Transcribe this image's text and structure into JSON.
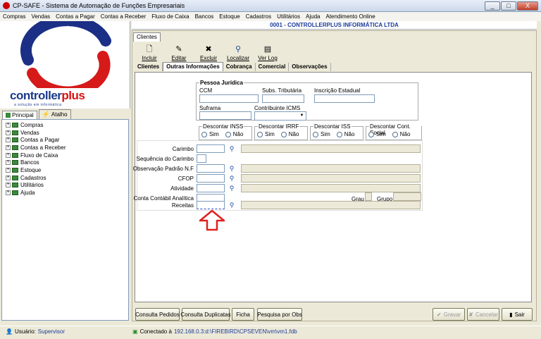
{
  "window": {
    "title": "CP-SAFE - Sistema de Automação de Funções Empresariais",
    "buttons": [
      "_",
      "□",
      "X"
    ]
  },
  "menu": [
    "Compras",
    "Vendas",
    "Contas a Pagar",
    "Contas a Receber",
    "Fluxo de Caixa",
    "Bancos",
    "Estoque",
    "Cadastros",
    "Utilitários",
    "Ajuda",
    "Atendimento Online"
  ],
  "logo": {
    "brand_a": "controller",
    "brand_b": "plus",
    "tagline": "a solução em informática"
  },
  "side_tabs": {
    "principal": "Principal",
    "atalho": "Atalho"
  },
  "tree": [
    "Compras",
    "Vendas",
    "Contas a Pagar",
    "Contas a Receber",
    "Fluxo de Caixa",
    "Bancos",
    "Estoque",
    "Cadastros",
    "Utilitários",
    "Ajuda"
  ],
  "company": "0001 - CONTROLLERPLUS INFORMÁTICA LTDA",
  "doc_tab": "Clientes",
  "toolbar": {
    "incluir": "Incluir",
    "editar": "Editar",
    "excluir": "Excluir",
    "localizar": "Localizar",
    "verlog": "Ver Log"
  },
  "subtabs": [
    "Clientes",
    "Outras Informações",
    "Cobrança",
    "Comercial",
    "Observações"
  ],
  "pj": {
    "title": "Pessoa Jurídica",
    "ccm": "CCM",
    "subs": "Subs. Tributária",
    "ie": "Inscrição Estadual",
    "suframa": "Suframa",
    "icms": "Contribuinte ICMS"
  },
  "descontos": [
    {
      "title": "Descontar INSS",
      "sim": "Sim",
      "nao": "Não"
    },
    {
      "title": "Descontar IRRF",
      "sim": "Sim",
      "nao": "Não"
    },
    {
      "title": "Descontar ISS",
      "sim": "Sim",
      "nao": "Não"
    },
    {
      "title": "Descontar Cont. Social",
      "sim": "Sim",
      "nao": "Não"
    }
  ],
  "fields": {
    "carimbo": "Carimbo",
    "seq_carimbo": "Sequência do Carimbo",
    "obs_nf": "Observação Padrão N.F",
    "cfop": "CFOP",
    "atividade": "Atividade",
    "conta": "Conta Contábil Analítica",
    "grau": "Grau",
    "grupo": "Grupo",
    "receitas": "Receitas"
  },
  "buttons": {
    "consulta_pedidos": "Consulta Pedidos",
    "consulta_duplicatas": "Consulta Duplicatas",
    "ficha": "Ficha",
    "pesquisa_obs": "Pesquisa por Obs",
    "gravar": "Gravar",
    "cancelar": "Cancelar",
    "sair": "Sair"
  },
  "status": {
    "user_label": "Usuário:",
    "user": "Supervisor",
    "conn_label": "Conectado à",
    "conn": "192.168.0.3:d:\\FIREBIRD\\CPSEVEN\\vm\\vm1.fdb"
  }
}
